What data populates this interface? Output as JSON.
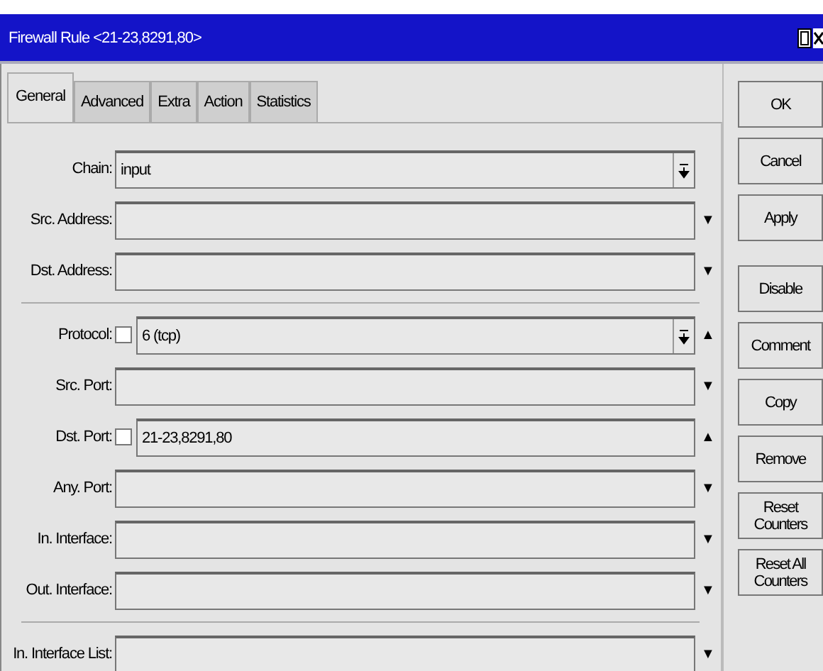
{
  "window": {
    "title": "Firewall Rule <21-23,8291,80>"
  },
  "tabs": [
    {
      "label": "General",
      "selected": true
    },
    {
      "label": "Advanced",
      "selected": false
    },
    {
      "label": "Extra",
      "selected": false
    },
    {
      "label": "Action",
      "selected": false
    },
    {
      "label": "Statistics",
      "selected": false
    }
  ],
  "groups": [
    [
      {
        "label": "Chain:",
        "value": "input",
        "kind": "select"
      },
      {
        "label": "Src. Address:",
        "kind": "text",
        "toggle": "▼"
      },
      {
        "label": "Dst. Address:",
        "kind": "text",
        "toggle": "▼"
      }
    ],
    [
      {
        "label": "Protocol:",
        "checked": false,
        "value": "6 (tcp)",
        "kind": "select",
        "toggle": "▲"
      },
      {
        "label": "Src. Port:",
        "kind": "text",
        "toggle": "▼"
      },
      {
        "label": "Dst. Port:",
        "checked": false,
        "value": "21-23,8291,80",
        "kind": "text",
        "toggle": "▲"
      },
      {
        "label": "Any. Port:",
        "kind": "text",
        "toggle": "▼"
      },
      {
        "label": "In. Interface:",
        "kind": "text",
        "toggle": "▼"
      },
      {
        "label": "Out. Interface:",
        "kind": "text",
        "toggle": "▼"
      }
    ],
    [
      {
        "label": "In. Interface List:",
        "kind": "text",
        "toggle": "▼"
      }
    ]
  ],
  "buttons": [
    {
      "label": "OK",
      "gap": false
    },
    {
      "label": "Cancel",
      "gap": false
    },
    {
      "label": "Apply",
      "gap": false
    },
    {
      "label": "Disable",
      "gap": true
    },
    {
      "label": "Comment",
      "gap": false
    },
    {
      "label": "Copy",
      "gap": false
    },
    {
      "label": "Remove",
      "gap": false
    },
    {
      "label": "Reset Counters",
      "gap": false
    },
    {
      "label": "Reset All Counters",
      "gap": false
    }
  ]
}
